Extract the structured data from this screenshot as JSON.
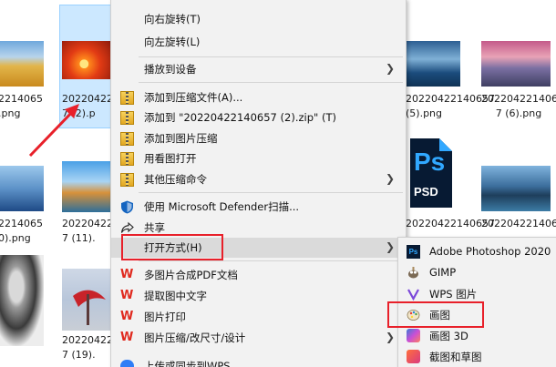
{
  "files": {
    "row1": [
      {
        "line1": "2214065",
        "line2": ".png"
      },
      {
        "line1": "20220422",
        "line2": "7 (2).p"
      },
      {
        "line1": "20220422140657",
        "line2": "(5).png"
      },
      {
        "line1": "20220422140657",
        "line2": "7 (6).png"
      }
    ],
    "row2": [
      {
        "line1": "2214065",
        "line2": "0).png"
      },
      {
        "line1": "20220422",
        "line2": "7 (11)."
      },
      {
        "line1": "20220422140657",
        "line2": ""
      },
      {
        "line1": "20220422140657",
        "line2": ""
      }
    ],
    "row3": [
      {
        "line1": "20220422",
        "line2": "7 (19)."
      }
    ],
    "psd_label": "PSD",
    "ps_label": "Ps"
  },
  "context_menu": {
    "items": [
      {
        "label": "向右旋转(T)"
      },
      {
        "label": "向左旋转(L)"
      },
      {
        "label": "播放到设备"
      },
      {
        "label": "添加到压缩文件(A)..."
      },
      {
        "label": "添加到 \"20220422140657 (2).zip\" (T)"
      },
      {
        "label": "添加到图片压缩"
      },
      {
        "label": "用看图打开"
      },
      {
        "label": "其他压缩命令"
      },
      {
        "label": "使用 Microsoft Defender扫描..."
      },
      {
        "label": "共享"
      },
      {
        "label": "打开方式(H)"
      },
      {
        "label": "多图片合成PDF文档"
      },
      {
        "label": "提取图中文字"
      },
      {
        "label": "图片打印"
      },
      {
        "label": "图片压缩/改尺寸/设计"
      },
      {
        "label": "上传或同步到WPS"
      }
    ]
  },
  "open_with_submenu": {
    "items": [
      {
        "label": "Adobe Photoshop 2020"
      },
      {
        "label": "GIMP"
      },
      {
        "label": "WPS 图片"
      },
      {
        "label": "画图"
      },
      {
        "label": "画图 3D"
      },
      {
        "label": "截图和草图"
      }
    ]
  },
  "colors": {
    "selection": "#cce8ff",
    "annotation_red": "#e8202a",
    "menu_bg": "#f2f2f2"
  }
}
